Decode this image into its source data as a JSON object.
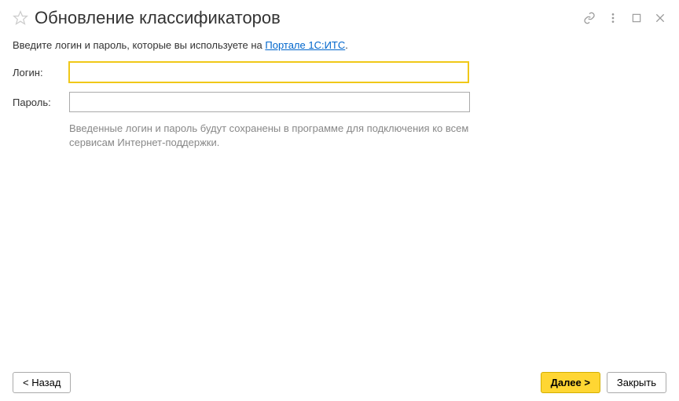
{
  "header": {
    "title": "Обновление классификаторов"
  },
  "intro": {
    "prefix": "Введите логин и пароль, которые вы используете на ",
    "link_text": "Портале 1С:ИТС",
    "suffix": "."
  },
  "form": {
    "login_label": "Логин:",
    "login_value": "",
    "password_label": "Пароль:",
    "password_value": ""
  },
  "hint": "Введенные логин и пароль будут сохранены в программе для подключения ко всем сервисам Интернет-поддержки.",
  "footer": {
    "back_label": "< Назад",
    "next_label": "Далее >",
    "close_label": "Закрыть"
  }
}
